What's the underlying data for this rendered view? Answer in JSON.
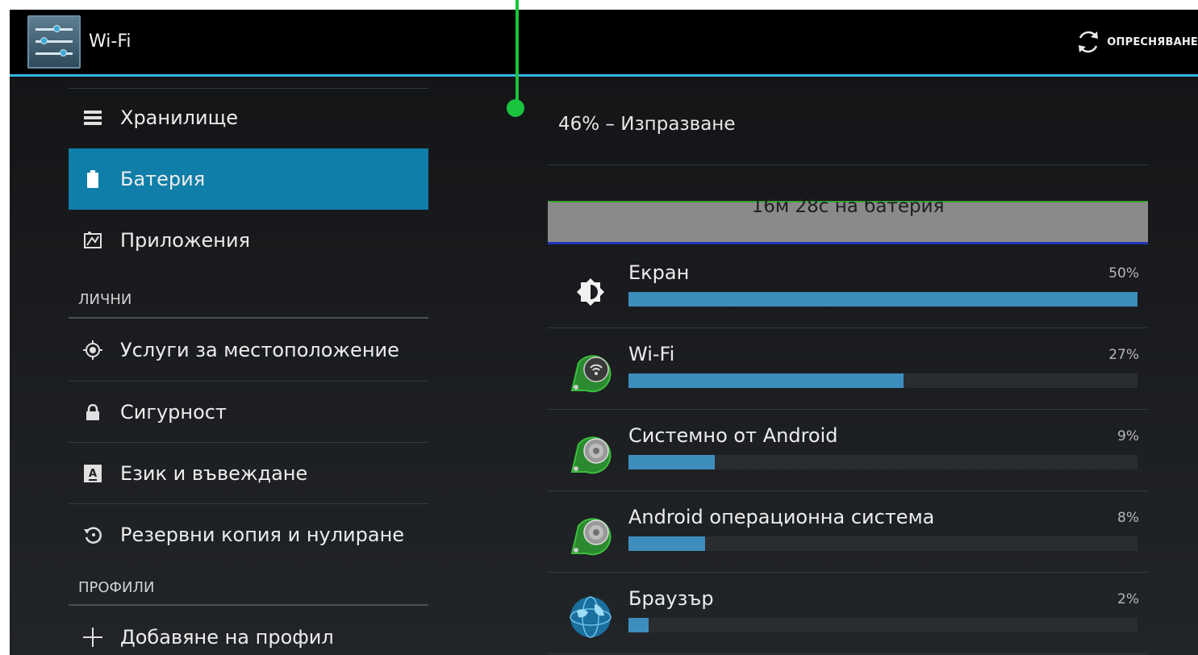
{
  "actionbar": {
    "title": "Wi-Fi",
    "refresh_label": "ОПРЕСНЯВАНЕ"
  },
  "sidebar": {
    "items": [
      {
        "label": "Хранилище",
        "icon": "storage-icon"
      },
      {
        "label": "Батерия",
        "icon": "battery-icon",
        "selected": true
      },
      {
        "label": "Приложения",
        "icon": "apps-icon"
      }
    ],
    "personal_header": "ЛИЧНИ",
    "personal_items": [
      {
        "label": "Услуги за местоположение",
        "icon": "location-icon"
      },
      {
        "label": "Сигурност",
        "icon": "lock-icon"
      },
      {
        "label": "Език и въвеждане",
        "icon": "keyboard-icon"
      },
      {
        "label": "Резервни копия и нулиране",
        "icon": "backup-icon"
      }
    ],
    "profiles_header": "ПРОФИЛИ",
    "add_profile_label": "Добавяне на профил"
  },
  "battery": {
    "status": "46% – Изпразване",
    "graph_label": "16м 28с на батерия",
    "usage": [
      {
        "name": "Екран",
        "percent": "50%",
        "fill": 1.0,
        "icon": "screen-brightness-icon"
      },
      {
        "name": "Wi-Fi",
        "percent": "27%",
        "fill": 0.54,
        "icon": "wifi-app-icon"
      },
      {
        "name": "Системно от Android",
        "percent": "9%",
        "fill": 0.17,
        "icon": "android-system-icon"
      },
      {
        "name": "Android операционна система",
        "percent": "8%",
        "fill": 0.15,
        "icon": "android-os-icon"
      },
      {
        "name": "Браузър",
        "percent": "2%",
        "fill": 0.04,
        "icon": "browser-globe-icon"
      }
    ]
  },
  "colors": {
    "accent": "#33b5e5",
    "selected": "#0f7ea8",
    "bar": "#3d8dbd",
    "marker": "#19c43d"
  }
}
